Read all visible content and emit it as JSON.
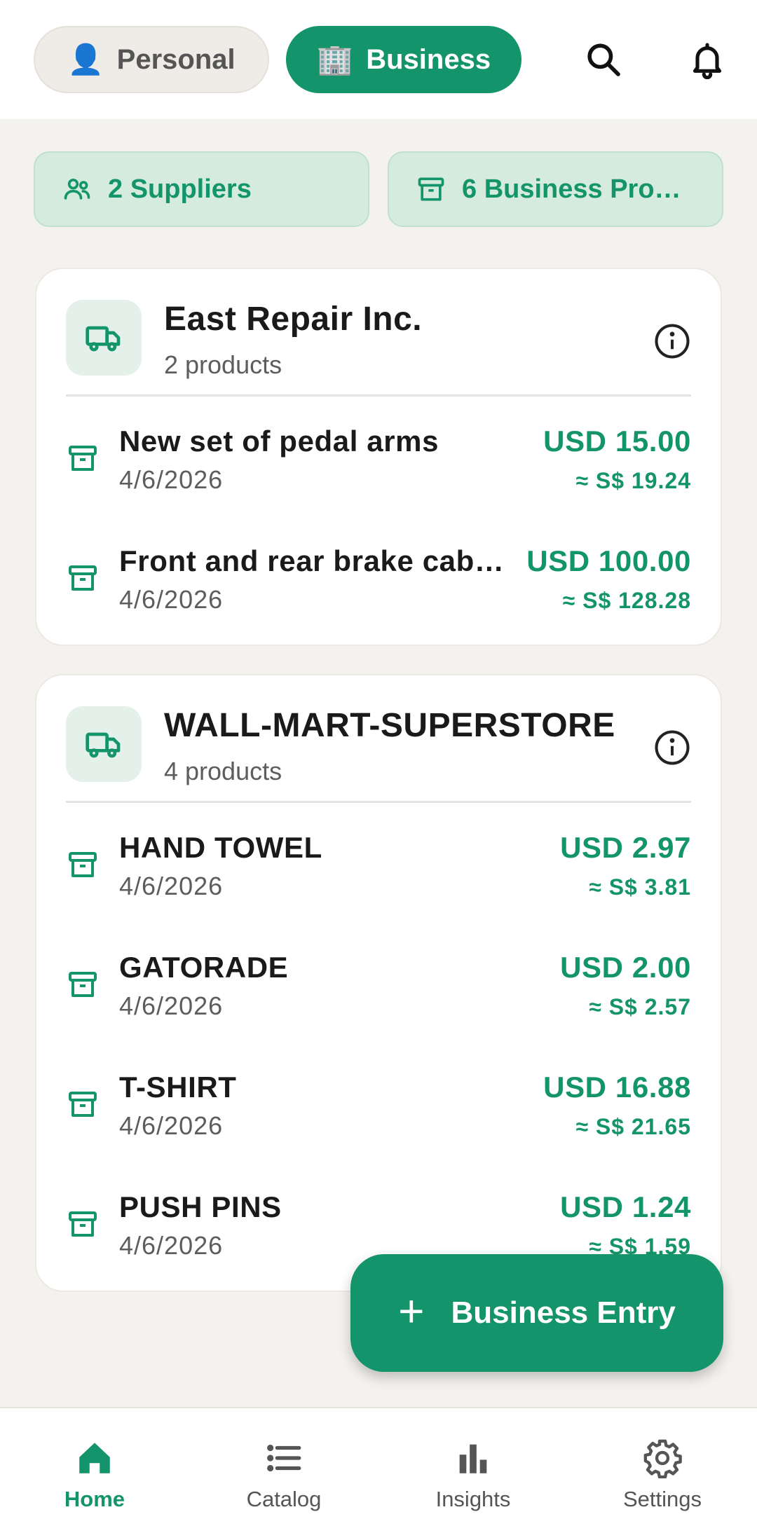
{
  "header": {
    "personal_emoji": "👤",
    "personal_label": "Personal",
    "business_emoji": "🏢",
    "business_label": "Business",
    "selected": "Business"
  },
  "chips": {
    "suppliers": "2 Suppliers",
    "products": "6 Business Pro…"
  },
  "suppliers": [
    {
      "name": "East Repair Inc.",
      "count": "2 products",
      "items": [
        {
          "name": "New set of pedal arms",
          "date": "4/6/2026",
          "price": "USD 15.00",
          "converted": "≈ S$ 19.24"
        },
        {
          "name": "Front and rear brake cab…",
          "date": "4/6/2026",
          "price": "USD 100.00",
          "converted": "≈ S$ 128.28"
        }
      ]
    },
    {
      "name": "WALL-MART-SUPERSTORE",
      "count": "4 products",
      "items": [
        {
          "name": "HAND TOWEL",
          "date": "4/6/2026",
          "price": "USD 2.97",
          "converted": "≈ S$ 3.81"
        },
        {
          "name": "GATORADE",
          "date": "4/6/2026",
          "price": "USD 2.00",
          "converted": "≈ S$ 2.57"
        },
        {
          "name": "T-SHIRT",
          "date": "4/6/2026",
          "price": "USD 16.88",
          "converted": "≈ S$ 21.65"
        },
        {
          "name": "PUSH PINS",
          "date": "4/6/2026",
          "price": "USD 1.24",
          "converted": "≈ S$ 1.59"
        }
      ]
    }
  ],
  "fab": {
    "plus": "+",
    "label": "Business Entry"
  },
  "nav": {
    "items": [
      {
        "label": "Home",
        "icon": "home-icon",
        "active": true
      },
      {
        "label": "Catalog",
        "icon": "list-icon",
        "active": false
      },
      {
        "label": "Insights",
        "icon": "bar-chart-icon",
        "active": false
      },
      {
        "label": "Settings",
        "icon": "gear-icon",
        "active": false
      }
    ]
  },
  "colors": {
    "accent": "#14946a",
    "chip_bg": "#d5ebde",
    "background": "#f4f2ee"
  }
}
